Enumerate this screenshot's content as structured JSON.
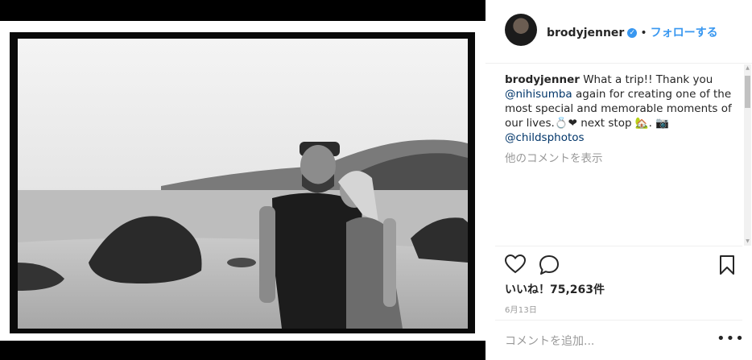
{
  "post": {
    "username": "brodyjenner",
    "verified_icon": "verified-badge-icon",
    "separator": "•",
    "follow_label": "フォローする",
    "caption_username": "brodyjenner",
    "caption_part1": "What a trip!! Thank you",
    "mention1": "@nihisumba",
    "caption_part2": "again for creating one of the most special and memorable moments of our lives.💍❤ next stop 🏡. 📷",
    "mention2": "@childsphotos",
    "more_comments": "他のコメントを表示",
    "likes": "いいね！75,263件",
    "date": "6月13日",
    "add_comment_placeholder": "コメントを追加...",
    "more_options": "•••"
  },
  "icons": {
    "like": "heart-icon",
    "comment": "comment-bubble-icon",
    "save": "bookmark-icon"
  },
  "colors": {
    "link_blue": "#3897f0",
    "text": "#262626",
    "muted": "#999999"
  }
}
